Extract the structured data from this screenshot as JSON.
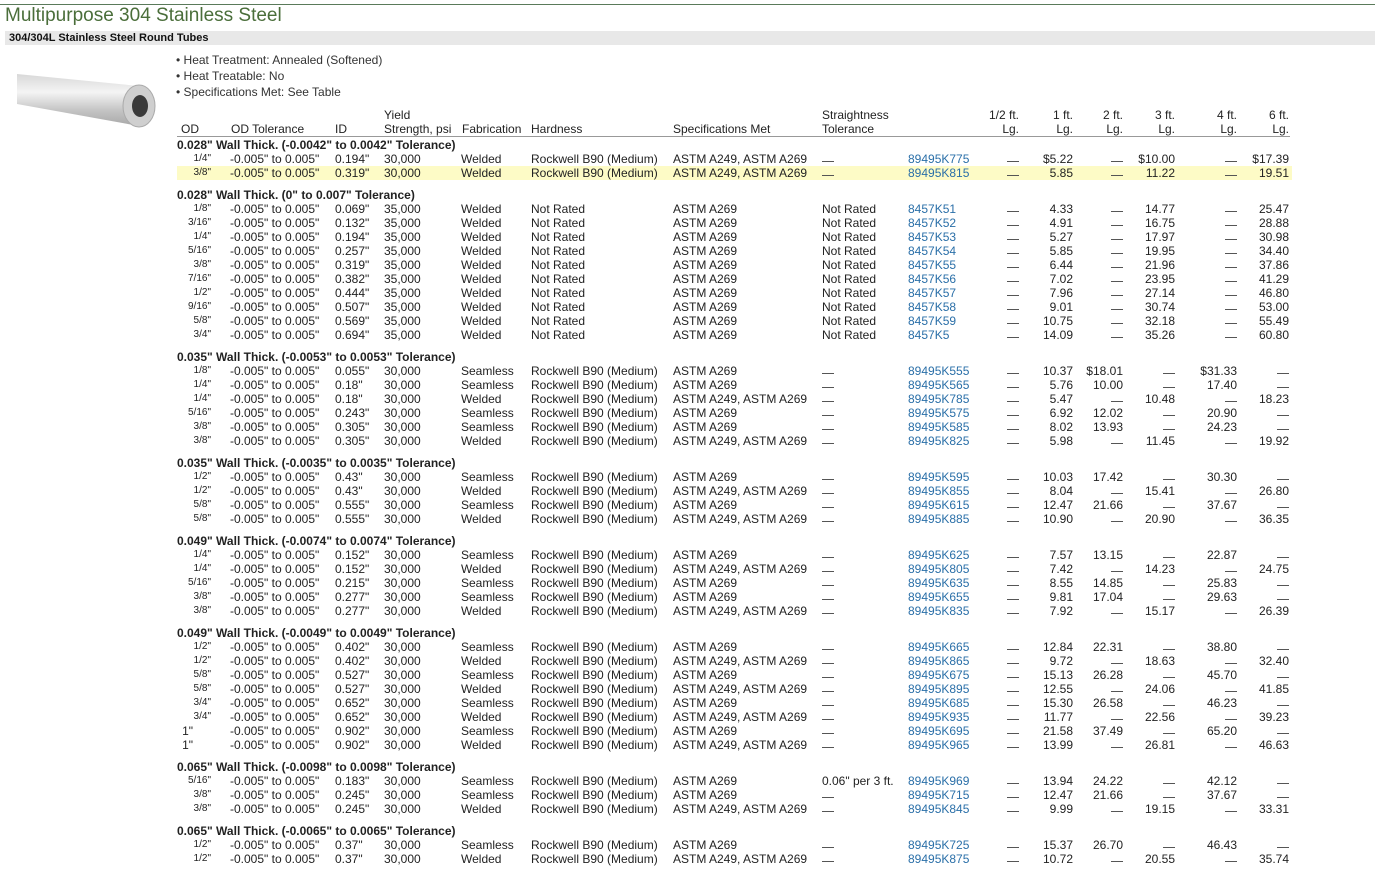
{
  "title": "Multipurpose 304 Stainless Steel",
  "subtitle": "304/304L Stainless Steel Round Tubes",
  "features": [
    "• Heat Treatment: Annealed (Softened)",
    "• Heat Treatable: No",
    "• Specifications Met: See Table"
  ],
  "columns": {
    "od": "OD",
    "od_tol": "OD Tolerance",
    "id": "ID",
    "ys1": "Yield",
    "ys2": "Strength, psi",
    "fab": "Fabrication",
    "hard": "Hardness",
    "spec": "Specifications Met",
    "str1": "Straightness",
    "str2": "Tolerance",
    "l0a": "1/2 ft.",
    "l0b": "Lg.",
    "l1a": "1 ft.",
    "l1b": "Lg.",
    "l2a": "2 ft.",
    "l2b": "Lg.",
    "l3a": "3 ft.",
    "l3b": "Lg.",
    "l4a": "4 ft.",
    "l4b": "Lg.",
    "l5a": "6 ft.",
    "l5b": "Lg."
  },
  "groups": [
    {
      "label": "0.028\" Wall Thick. (-0.0042\" to 0.0042\" Tolerance)",
      "rows": [
        [
          "1/4\"",
          "-0.005\" to 0.005\"",
          "0.194\"",
          "30,000",
          "Welded",
          "Rockwell B90 (Medium)",
          "ASTM A249, ASTM A269",
          "—",
          "89495K775",
          "—",
          "$5.22",
          "—",
          "$10.00",
          "—",
          "$17.39"
        ],
        [
          "3/8\"",
          "-0.005\" to 0.005\"",
          "0.319\"",
          "30,000",
          "Welded",
          "Rockwell B90 (Medium)",
          "ASTM A249, ASTM A269",
          "—",
          "89495K815",
          "—",
          "5.85",
          "—",
          "11.22",
          "—",
          "19.51"
        ]
      ]
    },
    {
      "label": "0.028\" Wall Thick. (0\" to 0.007\" Tolerance)",
      "rows": [
        [
          "1/8\"",
          "-0.005\" to 0.005\"",
          "0.069\"",
          "35,000",
          "Welded",
          "Not Rated",
          "ASTM A269",
          "Not Rated",
          "8457K51",
          "—",
          "4.33",
          "—",
          "14.77",
          "—",
          "25.47"
        ],
        [
          "3/16\"",
          "-0.005\" to 0.005\"",
          "0.132\"",
          "35,000",
          "Welded",
          "Not Rated",
          "ASTM A269",
          "Not Rated",
          "8457K52",
          "—",
          "4.91",
          "—",
          "16.75",
          "—",
          "28.88"
        ],
        [
          "1/4\"",
          "-0.005\" to 0.005\"",
          "0.194\"",
          "35,000",
          "Welded",
          "Not Rated",
          "ASTM A269",
          "Not Rated",
          "8457K53",
          "—",
          "5.27",
          "—",
          "17.97",
          "—",
          "30.98"
        ],
        [
          "5/16\"",
          "-0.005\" to 0.005\"",
          "0.257\"",
          "35,000",
          "Welded",
          "Not Rated",
          "ASTM A269",
          "Not Rated",
          "8457K54",
          "—",
          "5.85",
          "—",
          "19.95",
          "—",
          "34.40"
        ],
        [
          "3/8\"",
          "-0.005\" to 0.005\"",
          "0.319\"",
          "35,000",
          "Welded",
          "Not Rated",
          "ASTM A269",
          "Not Rated",
          "8457K55",
          "—",
          "6.44",
          "—",
          "21.96",
          "—",
          "37.86"
        ],
        [
          "7/16\"",
          "-0.005\" to 0.005\"",
          "0.382\"",
          "35,000",
          "Welded",
          "Not Rated",
          "ASTM A269",
          "Not Rated",
          "8457K56",
          "—",
          "7.02",
          "—",
          "23.95",
          "—",
          "41.29"
        ],
        [
          "1/2\"",
          "-0.005\" to 0.005\"",
          "0.444\"",
          "35,000",
          "Welded",
          "Not Rated",
          "ASTM A269",
          "Not Rated",
          "8457K57",
          "—",
          "7.96",
          "—",
          "27.14",
          "—",
          "46.80"
        ],
        [
          "9/16\"",
          "-0.005\" to 0.005\"",
          "0.507\"",
          "35,000",
          "Welded",
          "Not Rated",
          "ASTM A269",
          "Not Rated",
          "8457K58",
          "—",
          "9.01",
          "—",
          "30.74",
          "—",
          "53.00"
        ],
        [
          "5/8\"",
          "-0.005\" to 0.005\"",
          "0.569\"",
          "35,000",
          "Welded",
          "Not Rated",
          "ASTM A269",
          "Not Rated",
          "8457K59",
          "—",
          "10.75",
          "—",
          "32.18",
          "—",
          "55.49"
        ],
        [
          "3/4\"",
          "-0.005\" to 0.005\"",
          "0.694\"",
          "35,000",
          "Welded",
          "Not Rated",
          "ASTM A269",
          "Not Rated",
          "8457K5",
          "—",
          "14.09",
          "—",
          "35.26",
          "—",
          "60.80"
        ]
      ]
    },
    {
      "label": "0.035\" Wall Thick. (-0.0053\" to 0.0053\" Tolerance)",
      "rows": [
        [
          "1/8\"",
          "-0.005\" to 0.005\"",
          "0.055\"",
          "30,000",
          "Seamless",
          "Rockwell B90 (Medium)",
          "ASTM A269",
          "—",
          "89495K555",
          "—",
          "10.37",
          "$18.01",
          "—",
          "$31.33",
          "—"
        ],
        [
          "1/4\"",
          "-0.005\" to 0.005\"",
          "0.18\"",
          "30,000",
          "Seamless",
          "Rockwell B90 (Medium)",
          "ASTM A269",
          "—",
          "89495K565",
          "—",
          "5.76",
          "10.00",
          "—",
          "17.40",
          "—"
        ],
        [
          "1/4\"",
          "-0.005\" to 0.005\"",
          "0.18\"",
          "30,000",
          "Welded",
          "Rockwell B90 (Medium)",
          "ASTM A249, ASTM A269",
          "—",
          "89495K785",
          "—",
          "5.47",
          "—",
          "10.48",
          "—",
          "18.23"
        ],
        [
          "5/16\"",
          "-0.005\" to 0.005\"",
          "0.243\"",
          "30,000",
          "Seamless",
          "Rockwell B90 (Medium)",
          "ASTM A269",
          "—",
          "89495K575",
          "—",
          "6.92",
          "12.02",
          "—",
          "20.90",
          "—"
        ],
        [
          "3/8\"",
          "-0.005\" to 0.005\"",
          "0.305\"",
          "30,000",
          "Seamless",
          "Rockwell B90 (Medium)",
          "ASTM A269",
          "—",
          "89495K585",
          "—",
          "8.02",
          "13.93",
          "—",
          "24.23",
          "—"
        ],
        [
          "3/8\"",
          "-0.005\" to 0.005\"",
          "0.305\"",
          "30,000",
          "Welded",
          "Rockwell B90 (Medium)",
          "ASTM A249, ASTM A269",
          "—",
          "89495K825",
          "—",
          "5.98",
          "—",
          "11.45",
          "—",
          "19.92"
        ]
      ]
    },
    {
      "label": "0.035\" Wall Thick. (-0.0035\" to 0.0035\" Tolerance)",
      "rows": [
        [
          "1/2\"",
          "-0.005\" to 0.005\"",
          "0.43\"",
          "30,000",
          "Seamless",
          "Rockwell B90 (Medium)",
          "ASTM A269",
          "—",
          "89495K595",
          "—",
          "10.03",
          "17.42",
          "—",
          "30.30",
          "—"
        ],
        [
          "1/2\"",
          "-0.005\" to 0.005\"",
          "0.43\"",
          "30,000",
          "Welded",
          "Rockwell B90 (Medium)",
          "ASTM A249, ASTM A269",
          "—",
          "89495K855",
          "—",
          "8.04",
          "—",
          "15.41",
          "—",
          "26.80"
        ],
        [
          "5/8\"",
          "-0.005\" to 0.005\"",
          "0.555\"",
          "30,000",
          "Seamless",
          "Rockwell B90 (Medium)",
          "ASTM A269",
          "—",
          "89495K615",
          "—",
          "12.47",
          "21.66",
          "—",
          "37.67",
          "—"
        ],
        [
          "5/8\"",
          "-0.005\" to 0.005\"",
          "0.555\"",
          "30,000",
          "Welded",
          "Rockwell B90 (Medium)",
          "ASTM A249, ASTM A269",
          "—",
          "89495K885",
          "—",
          "10.90",
          "—",
          "20.90",
          "—",
          "36.35"
        ]
      ]
    },
    {
      "label": "0.049\" Wall Thick. (-0.0074\" to 0.0074\" Tolerance)",
      "rows": [
        [
          "1/4\"",
          "-0.005\" to 0.005\"",
          "0.152\"",
          "30,000",
          "Seamless",
          "Rockwell B90 (Medium)",
          "ASTM A269",
          "—",
          "89495K625",
          "—",
          "7.57",
          "13.15",
          "—",
          "22.87",
          "—"
        ],
        [
          "1/4\"",
          "-0.005\" to 0.005\"",
          "0.152\"",
          "30,000",
          "Welded",
          "Rockwell B90 (Medium)",
          "ASTM A249, ASTM A269",
          "—",
          "89495K805",
          "—",
          "7.42",
          "—",
          "14.23",
          "—",
          "24.75"
        ],
        [
          "5/16\"",
          "-0.005\" to 0.005\"",
          "0.215\"",
          "30,000",
          "Seamless",
          "Rockwell B90 (Medium)",
          "ASTM A269",
          "—",
          "89495K635",
          "—",
          "8.55",
          "14.85",
          "—",
          "25.83",
          "—"
        ],
        [
          "3/8\"",
          "-0.005\" to 0.005\"",
          "0.277\"",
          "30,000",
          "Seamless",
          "Rockwell B90 (Medium)",
          "ASTM A269",
          "—",
          "89495K655",
          "—",
          "9.81",
          "17.04",
          "—",
          "29.63",
          "—"
        ],
        [
          "3/8\"",
          "-0.005\" to 0.005\"",
          "0.277\"",
          "30,000",
          "Welded",
          "Rockwell B90 (Medium)",
          "ASTM A249, ASTM A269",
          "—",
          "89495K835",
          "—",
          "7.92",
          "—",
          "15.17",
          "—",
          "26.39"
        ]
      ]
    },
    {
      "label": "0.049\" Wall Thick. (-0.0049\" to 0.0049\" Tolerance)",
      "rows": [
        [
          "1/2\"",
          "-0.005\" to 0.005\"",
          "0.402\"",
          "30,000",
          "Seamless",
          "Rockwell B90 (Medium)",
          "ASTM A269",
          "—",
          "89495K665",
          "—",
          "12.84",
          "22.31",
          "—",
          "38.80",
          "—"
        ],
        [
          "1/2\"",
          "-0.005\" to 0.005\"",
          "0.402\"",
          "30,000",
          "Welded",
          "Rockwell B90 (Medium)",
          "ASTM A249, ASTM A269",
          "—",
          "89495K865",
          "—",
          "9.72",
          "—",
          "18.63",
          "—",
          "32.40"
        ],
        [
          "5/8\"",
          "-0.005\" to 0.005\"",
          "0.527\"",
          "30,000",
          "Seamless",
          "Rockwell B90 (Medium)",
          "ASTM A269",
          "—",
          "89495K675",
          "—",
          "15.13",
          "26.28",
          "—",
          "45.70",
          "—"
        ],
        [
          "5/8\"",
          "-0.005\" to 0.005\"",
          "0.527\"",
          "30,000",
          "Welded",
          "Rockwell B90 (Medium)",
          "ASTM A249, ASTM A269",
          "—",
          "89495K895",
          "—",
          "12.55",
          "—",
          "24.06",
          "—",
          "41.85"
        ],
        [
          "3/4\"",
          "-0.005\" to 0.005\"",
          "0.652\"",
          "30,000",
          "Seamless",
          "Rockwell B90 (Medium)",
          "ASTM A269",
          "—",
          "89495K685",
          "—",
          "15.30",
          "26.58",
          "—",
          "46.23",
          "—"
        ],
        [
          "3/4\"",
          "-0.005\" to 0.005\"",
          "0.652\"",
          "30,000",
          "Welded",
          "Rockwell B90 (Medium)",
          "ASTM A249, ASTM A269",
          "—",
          "89495K935",
          "—",
          "11.77",
          "—",
          "22.56",
          "—",
          "39.23"
        ],
        [
          "1\"",
          "-0.005\" to 0.005\"",
          "0.902\"",
          "30,000",
          "Seamless",
          "Rockwell B90 (Medium)",
          "ASTM A269",
          "—",
          "89495K695",
          "—",
          "21.58",
          "37.49",
          "—",
          "65.20",
          "—"
        ],
        [
          "1\"",
          "-0.005\" to 0.005\"",
          "0.902\"",
          "30,000",
          "Welded",
          "Rockwell B90 (Medium)",
          "ASTM A249, ASTM A269",
          "—",
          "89495K965",
          "—",
          "13.99",
          "—",
          "26.81",
          "—",
          "46.63"
        ]
      ]
    },
    {
      "label": "0.065\" Wall Thick. (-0.0098\" to 0.0098\" Tolerance)",
      "rows": [
        [
          "5/16\"",
          "-0.005\" to 0.005\"",
          "0.183\"",
          "30,000",
          "Seamless",
          "Rockwell B90 (Medium)",
          "ASTM A269",
          "0.06\" per 3 ft.",
          "89495K969",
          "—",
          "13.94",
          "24.22",
          "—",
          "42.12",
          "—"
        ],
        [
          "3/8\"",
          "-0.005\" to 0.005\"",
          "0.245\"",
          "30,000",
          "Seamless",
          "Rockwell B90 (Medium)",
          "ASTM A269",
          "—",
          "89495K715",
          "—",
          "12.47",
          "21.66",
          "—",
          "37.67",
          "—"
        ],
        [
          "3/8\"",
          "-0.005\" to 0.005\"",
          "0.245\"",
          "30,000",
          "Welded",
          "Rockwell B90 (Medium)",
          "ASTM A249, ASTM A269",
          "—",
          "89495K845",
          "—",
          "9.99",
          "—",
          "19.15",
          "—",
          "33.31"
        ]
      ]
    },
    {
      "label": "0.065\" Wall Thick. (-0.0065\" to 0.0065\" Tolerance)",
      "rows": [
        [
          "1/2\"",
          "-0.005\" to 0.005\"",
          "0.37\"",
          "30,000",
          "Seamless",
          "Rockwell B90 (Medium)",
          "ASTM A269",
          "—",
          "89495K725",
          "—",
          "15.37",
          "26.70",
          "—",
          "46.43",
          "—"
        ],
        [
          "1/2\"",
          "-0.005\" to 0.005\"",
          "0.37\"",
          "30,000",
          "Welded",
          "Rockwell B90 (Medium)",
          "ASTM A249, ASTM A269",
          "—",
          "89495K875",
          "—",
          "10.72",
          "—",
          "20.55",
          "—",
          "35.74"
        ]
      ]
    }
  ],
  "highlight_color": "#fdfbc6",
  "link_color": "#2a6fa8",
  "title_color": "#4a6e3a"
}
